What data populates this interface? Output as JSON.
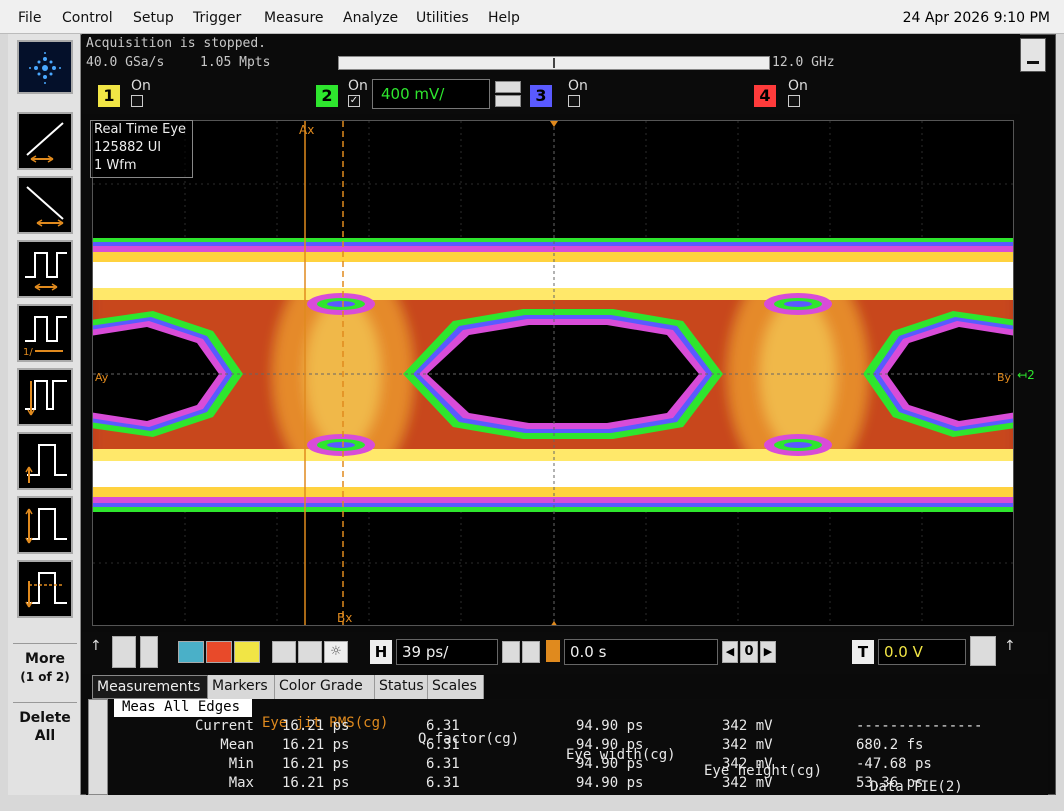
{
  "menubar": {
    "items": [
      "File",
      "Control",
      "Setup",
      "Trigger",
      "Measure",
      "Analyze",
      "Utilities",
      "Help"
    ],
    "datetime": "24 Apr 2026  9:10 PM"
  },
  "acquisition": {
    "status": "Acquisition is stopped.",
    "rate": "40.0 GSa/s",
    "depth": "1.05 Mpts",
    "bandwidth": "12.0 GHz"
  },
  "channels": [
    {
      "number": "1",
      "on_label": "On",
      "color": "#f1e545",
      "checked": false
    },
    {
      "number": "2",
      "on_label": "On",
      "color": "#2ee62e",
      "checked": true,
      "scale": "400 mV/"
    },
    {
      "number": "3",
      "on_label": "On",
      "color": "#5a5aff",
      "checked": false
    },
    {
      "number": "4",
      "on_label": "On",
      "color": "#ff3b3b",
      "checked": false
    }
  ],
  "display": {
    "info": [
      "Real Time Eye",
      "125882 UI",
      "1 Wfm"
    ],
    "marker_ax": "Ax",
    "marker_bx": "Bx",
    "marker_ay": "Ay",
    "marker_by": "By",
    "channel_ref": "2"
  },
  "sidebar": {
    "more_label": "More",
    "more_page": "(1 of 2)",
    "delete_label": "Delete",
    "delete_label2": "All"
  },
  "controls": {
    "timebase_key": "H",
    "timebase": "39 ps/",
    "delay": "0.0 s",
    "nav_value": "0",
    "trigger_key": "T",
    "trigger_level": "0.0 V"
  },
  "tabs": [
    "Measurements",
    "Markers",
    "Color Grade",
    "Status",
    "Scales"
  ],
  "measurements": {
    "scope": "Meas All Edges",
    "headers": [
      "Eye jit RMS(cg)",
      "Q-factor(cg)",
      "Eye width(cg)",
      "Eye height(cg)",
      "Data TIE(2)"
    ],
    "rows": [
      {
        "label": "Current",
        "values": [
          "16.21 ps",
          "6.31",
          "94.90 ps",
          "342 mV",
          "---------------"
        ]
      },
      {
        "label": "Mean",
        "values": [
          "16.21 ps",
          "6.31",
          "94.90 ps",
          "342 mV",
          "680.2 fs"
        ]
      },
      {
        "label": "Min",
        "values": [
          "16.21 ps",
          "6.31",
          "94.90 ps",
          "342 mV",
          "-47.68 ps"
        ]
      },
      {
        "label": "Max",
        "values": [
          "16.21 ps",
          "6.31",
          "94.90 ps",
          "342 mV",
          "53.36 ps"
        ]
      }
    ]
  },
  "colors": {
    "ch1": "#f1e545",
    "ch2": "#2ee62e",
    "ch3": "#5a5aff",
    "ch4": "#ff3b3b",
    "marker": "#e08a1e",
    "eye_hot": "#ffffff",
    "eye_mid": "#ffd23f"
  }
}
